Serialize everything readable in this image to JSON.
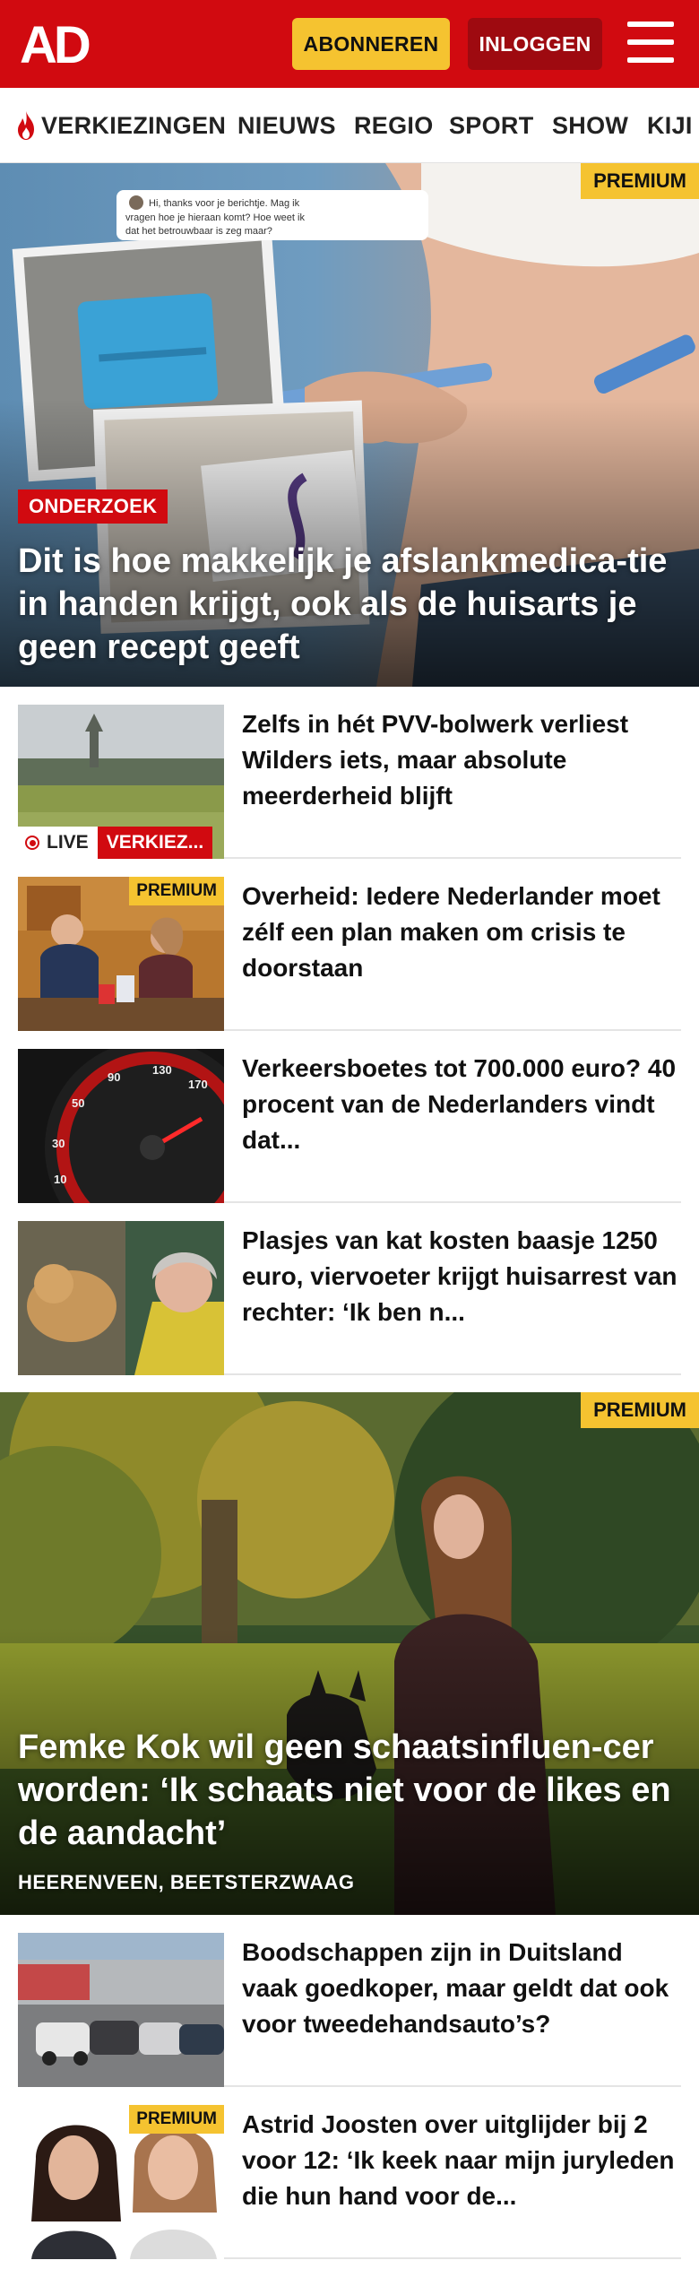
{
  "header": {
    "logo_text": "AD",
    "subscribe_label": "ABONNEREN",
    "login_label": "INLOGGEN"
  },
  "nav": {
    "items": [
      {
        "label": "VERKIEZINGEN",
        "icon": "flame-icon"
      },
      {
        "label": "NIEUWS"
      },
      {
        "label": "REGIO"
      },
      {
        "label": "SPORT"
      },
      {
        "label": "SHOW"
      },
      {
        "label": "KIJI"
      }
    ]
  },
  "colors": {
    "brand_red": "#d10a10",
    "dark_red": "#9e0a10",
    "premium_yellow": "#f5c330"
  },
  "hero1": {
    "premium_label": "PREMIUM",
    "tag": "ONDERZOEK",
    "title": "Dit is hoe makkelijk je afslankmedica-tie in handen krijgt, ook als de huisarts je geen recept geeft",
    "chat_bubble": "Hi, thanks voor je berichtje. Mag ik vragen hoe je hieraan komt? Hoe weet ik dat het betrouwbaar is zeg maar?"
  },
  "list1": [
    {
      "title": "Zelfs in hét PVV-bolwerk verliest Wilders iets, maar absolute meerderheid blijft",
      "live_label": "LIVE",
      "live_topic": "VERKIEZ..."
    },
    {
      "title": "Overheid: Iedere Nederlander moet zélf een plan maken om crisis te doorstaan",
      "premium_label": "PREMIUM"
    },
    {
      "title": "Verkeersboetes tot 700.000 euro? 40 procent van de Nederlanders vindt dat..."
    },
    {
      "title": "Plasjes van kat kosten baasje 1250 euro, viervoeter krijgt huisarrest van rechter: ‘Ik ben n..."
    }
  ],
  "hero2": {
    "premium_label": "PREMIUM",
    "title": "Femke Kok wil geen schaatsinfluen-cer worden: ‘Ik schaats niet voor de likes en de aandacht’",
    "location": "HEERENVEEN, BEETSTERZWAAG"
  },
  "list2": [
    {
      "title": "Boodschappen zijn in Duitsland vaak goedkoper, maar geldt dat ook voor tweedehandsauto’s?"
    },
    {
      "title": "Astrid Joosten over uitglijder bij 2 voor 12: ‘Ik keek naar mijn juryleden die hun hand voor de...",
      "premium_label": "PREMIUM"
    }
  ]
}
